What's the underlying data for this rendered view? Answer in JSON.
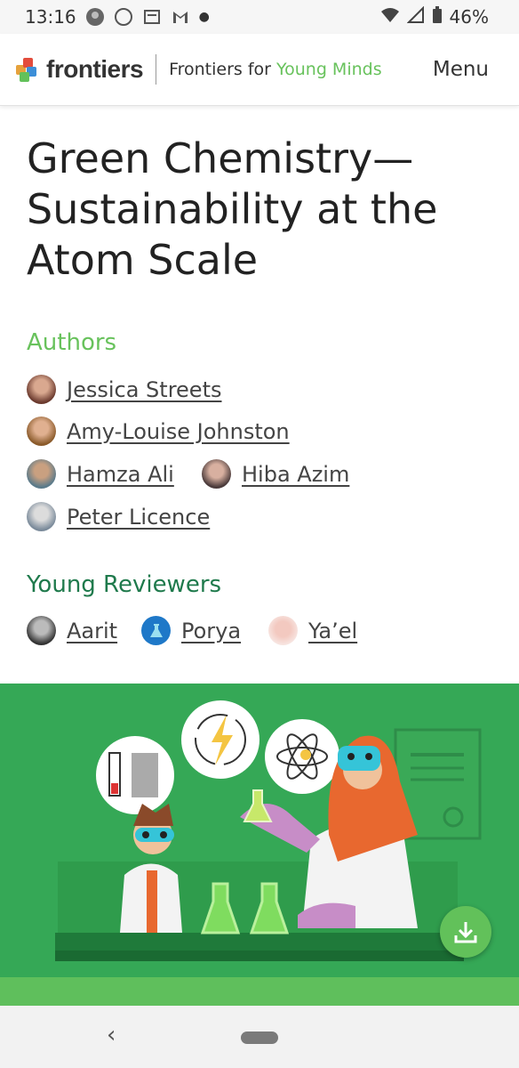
{
  "status_bar": {
    "time": "13:16",
    "battery": "46%",
    "icons": [
      "avatar-icon",
      "whatsapp-icon",
      "news-icon",
      "gmail-icon",
      "dot-icon",
      "wifi-icon",
      "signal-icon",
      "battery-icon"
    ]
  },
  "header": {
    "logo_text": "frontiers",
    "subtitle_prefix": "Frontiers for ",
    "subtitle_highlight": "Young Minds",
    "menu_label": "Menu"
  },
  "article": {
    "title": "Green Chemistry—Sustainability at the Atom Scale"
  },
  "authors": {
    "heading": "Authors",
    "list": [
      "Jessica Streets",
      "Amy-Louise Johnston",
      "Hamza Ali",
      "Hiba Azim",
      "Peter Licence"
    ]
  },
  "reviewers": {
    "heading": "Young Reviewers",
    "list": [
      "Aarit",
      "Porya",
      "Ya’el"
    ]
  },
  "colors": {
    "accent_green": "#68c25c",
    "dark_green": "#1f7a4c",
    "banner_green": "#35a856"
  }
}
